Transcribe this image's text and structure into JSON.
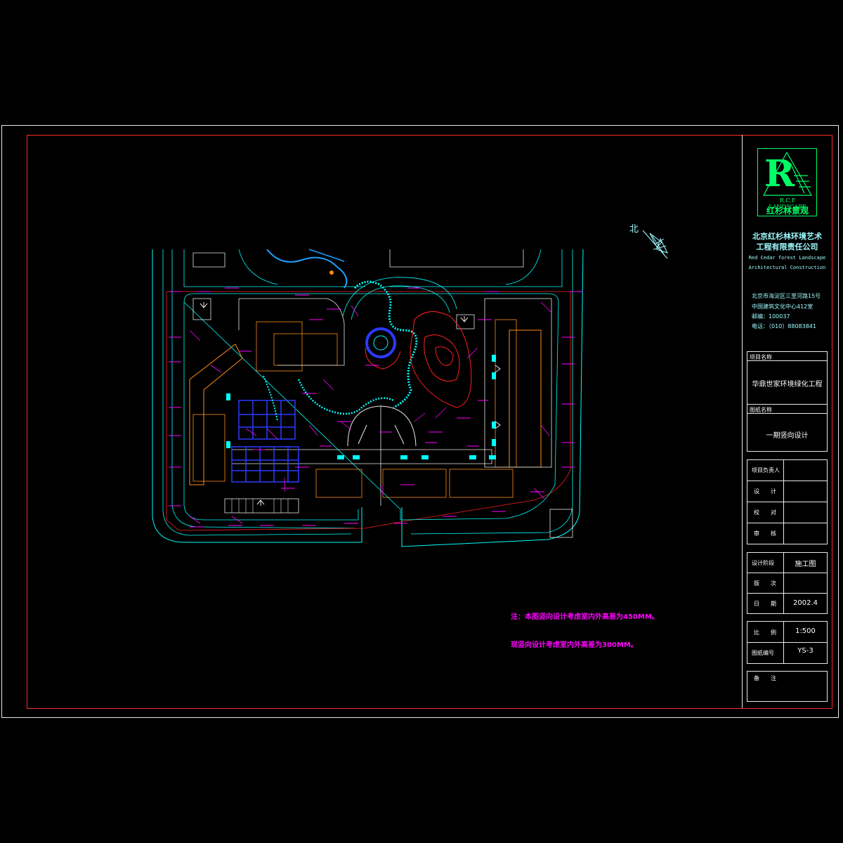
{
  "north_label": "北",
  "logo": {
    "letter": "R",
    "english": "R.C.F LANDSCAPE",
    "chinese": "红杉林景观"
  },
  "company": {
    "name_line1": "北京红杉林环境艺术",
    "name_line2": "工程有限责任公司",
    "english_line1": "Red Cedar forest Landscape",
    "english_line2": "Architectural Construction",
    "address": "北京市海淀区三里河路15号",
    "building": "中国建筑文化中心412室",
    "postcode": "邮编：100037",
    "phone": "电话：（010）88083841"
  },
  "title_block": {
    "project_name_label": "项目名称",
    "project_name": "华鼎世家环境绿化工程",
    "drawing_name_label": "图纸名称",
    "drawing_name": "一期竖向设计",
    "project_lead_label": "项目负责人",
    "design_label": "设　　计",
    "check_label": "校　　对",
    "review_label": "审　　核",
    "phase_label": "设计阶段",
    "phase_value": "施工图",
    "version_label": "版　　次",
    "date_label": "日　　期",
    "date_value": "2002.4",
    "scale_label": "比　　例",
    "scale_value": "1:500",
    "drawing_no_label": "图纸编号",
    "drawing_no_value": "YS-3",
    "remark_label": "备　　注"
  },
  "notes": {
    "note1": "注：本图竖向设计考虑室内外高差为450MM。",
    "note2": "现竖向设计考虑室内外高差为300MM。"
  },
  "colors": {
    "frame_red": "#ff2a2a",
    "outline_cyan": "#00ffff",
    "annotation_magenta": "#ff00ff",
    "building_orange": "#ff8c1a",
    "contour_red": "#ff2020",
    "paving_blue": "#2b3bff",
    "water_blue": "#1aa0ff",
    "logo_green": "#00ff66",
    "frame_white": "#e8e8e8"
  }
}
